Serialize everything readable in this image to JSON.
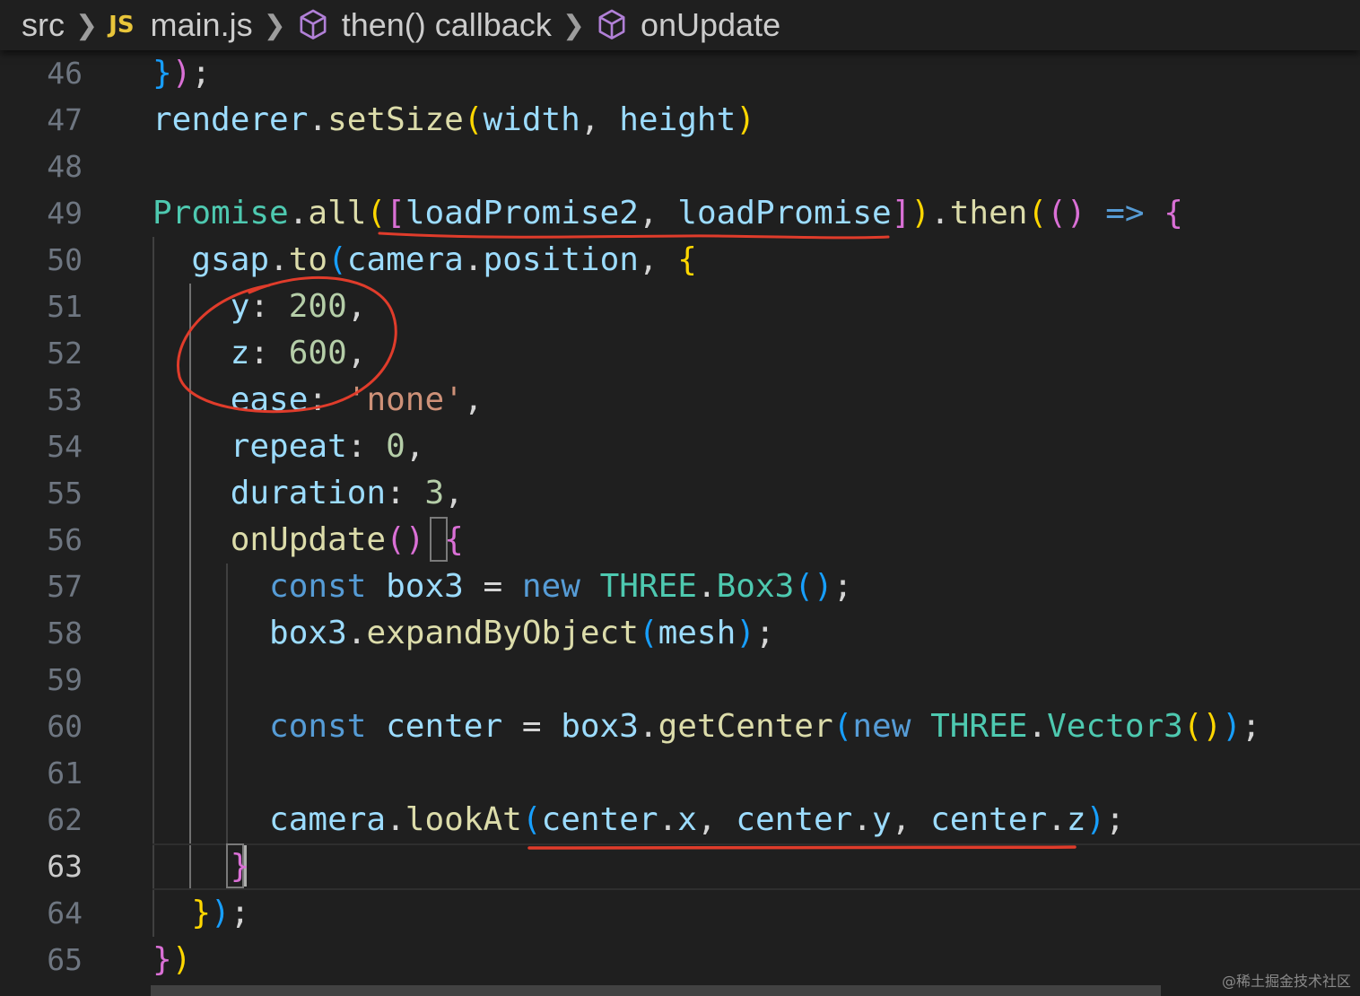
{
  "breadcrumb": {
    "folder": "src",
    "file_badge": "JS",
    "file": "main.js",
    "symbol1": "then() callback",
    "symbol2": "onUpdate"
  },
  "icons": {
    "separator": "chevron-right-icon",
    "symbol": "cube-icon"
  },
  "editor": {
    "active_line": "63",
    "lines": [
      {
        "num": "46"
      },
      {
        "num": "47"
      },
      {
        "num": "48"
      },
      {
        "num": "49"
      },
      {
        "num": "50"
      },
      {
        "num": "51"
      },
      {
        "num": "52"
      },
      {
        "num": "53"
      },
      {
        "num": "54"
      },
      {
        "num": "55"
      },
      {
        "num": "56"
      },
      {
        "num": "57"
      },
      {
        "num": "58"
      },
      {
        "num": "59"
      },
      {
        "num": "60"
      },
      {
        "num": "61"
      },
      {
        "num": "62"
      },
      {
        "num": "63"
      },
      {
        "num": "64"
      },
      {
        "num": "65"
      }
    ],
    "tokens": {
      "renderer": "renderer",
      "setSize": "setSize",
      "width": "width",
      "height": "height",
      "Promise": "Promise",
      "all": "all",
      "loadPromise2": "loadPromise2",
      "loadPromise": "loadPromise",
      "then": "then",
      "arrow": "=>",
      "gsap": "gsap",
      "to": "to",
      "camera": "camera",
      "position": "position",
      "y": "y",
      "y_val": "200",
      "z": "z",
      "z_val": "600",
      "ease": "ease",
      "ease_val": "'none'",
      "repeat": "repeat",
      "repeat_val": "0",
      "duration": "duration",
      "duration_val": "3",
      "onUpdate": "onUpdate",
      "const": "const",
      "box3": "box3",
      "new": "new",
      "THREE": "THREE",
      "Box3": "Box3",
      "expandByObject": "expandByObject",
      "mesh": "mesh",
      "center": "center",
      "getCenter": "getCenter",
      "Vector3": "Vector3",
      "lookAt": "lookAt",
      "x": "x"
    }
  },
  "annotations": {
    "color": "#e03c2b"
  },
  "watermark": "@稀土掘金技术社区",
  "colors": {
    "background": "#1f1f1f",
    "keyword": "#569cd6",
    "variable": "#9cdcfe",
    "function": "#dcdcaa",
    "class": "#4ec9b0",
    "number": "#b5cea8",
    "string": "#ce9178",
    "bracket1": "#ffd700",
    "bracket2": "#da70d6",
    "bracket3": "#179fff"
  }
}
